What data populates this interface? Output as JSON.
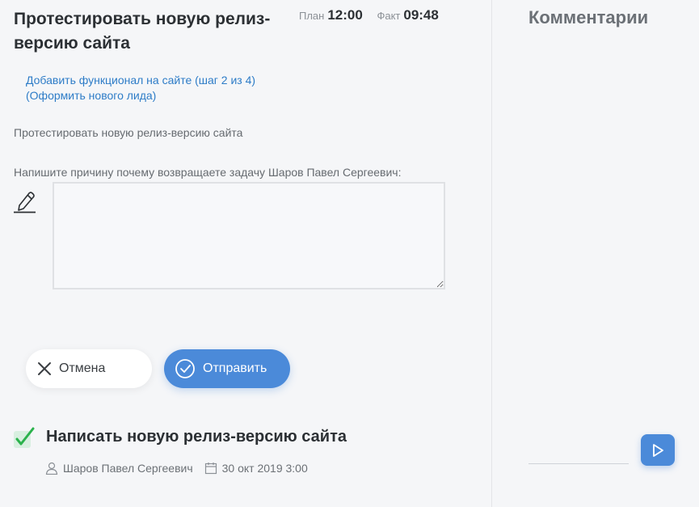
{
  "task": {
    "title": "Протестировать новую релиз-версию сайта",
    "plan_label": "План",
    "plan_value": "12:00",
    "fact_label": "Факт",
    "fact_value": "09:48",
    "parent_link": "Добавить функционал на сайте (шаг 2 из 4) (Оформить нового лида)",
    "description": "Протестировать новую релиз-версию сайта",
    "reason_label": "Напишите причину почему возвращаете задачу Шаров Павел Сергеевич:",
    "reason_value": ""
  },
  "actions": {
    "cancel_label": "Отмена",
    "send_label": "Отправить"
  },
  "subtask": {
    "title": "Написать новую релиз-версию сайта",
    "assignee": "Шаров Павел Сергеевич",
    "date": "30 окт 2019 3:00",
    "completed": true
  },
  "comments": {
    "title": "Комментарии",
    "input_value": ""
  },
  "colors": {
    "accent": "#4b8ad9",
    "link": "#2d7cc7",
    "check": "#2bb24c"
  },
  "icons": [
    "pencil-icon",
    "close-icon",
    "check-circle-icon",
    "checkmark-icon",
    "user-icon",
    "calendar-icon",
    "play-icon"
  ]
}
